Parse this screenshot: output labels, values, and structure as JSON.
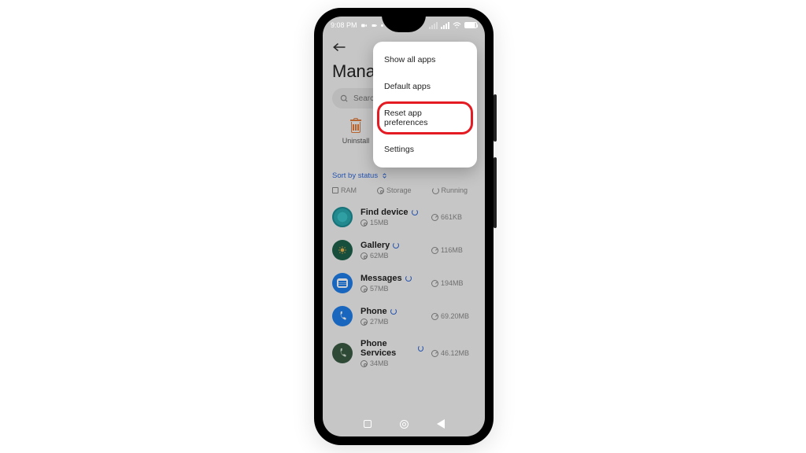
{
  "status": {
    "time": "9:08 PM"
  },
  "header": {
    "title": "Manage"
  },
  "search": {
    "placeholder": "Search a"
  },
  "action": {
    "uninstall_label": "Uninstall"
  },
  "sort": {
    "label": "Sort by status"
  },
  "meta": {
    "ram": "RAM",
    "storage": "Storage",
    "running": "Running"
  },
  "apps": [
    {
      "name": "Find device",
      "storage": "15MB",
      "runtime": "661KB"
    },
    {
      "name": "Gallery",
      "storage": "62MB",
      "runtime": "116MB"
    },
    {
      "name": "Messages",
      "storage": "57MB",
      "runtime": "194MB"
    },
    {
      "name": "Phone",
      "storage": "27MB",
      "runtime": "69.20MB"
    },
    {
      "name": "Phone Services",
      "storage": "34MB",
      "runtime": "46.12MB"
    }
  ],
  "popup": {
    "items": [
      "Show all apps",
      "Default apps",
      "Reset app preferences",
      "Settings"
    ],
    "highlight_index": 2
  }
}
